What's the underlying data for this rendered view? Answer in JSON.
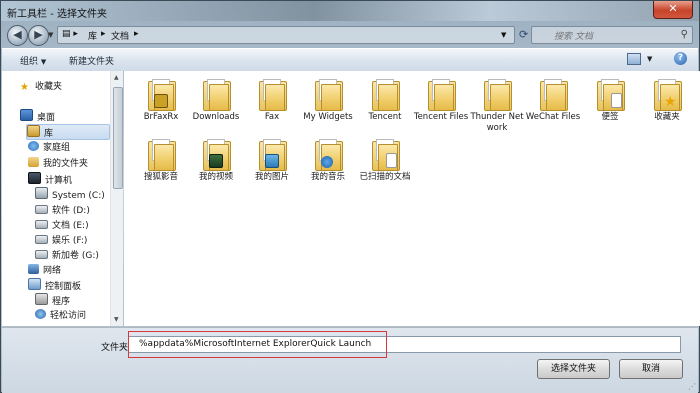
{
  "window": {
    "title": "新工具栏 - 选择文件夹",
    "close": "✕"
  },
  "address": {
    "crumbs": [
      "库",
      "文档"
    ],
    "search_placeholder": "搜索 文档"
  },
  "toolbar": {
    "organize": "组织",
    "new_folder": "新建文件夹",
    "help": "?"
  },
  "sidebar": {
    "items": [
      {
        "label": "收藏夹",
        "icon": "star-icon"
      },
      {
        "label": "桌面",
        "icon": "desktop-icon"
      },
      {
        "label": "库",
        "icon": "library-icon"
      },
      {
        "label": "家庭组",
        "icon": "homegroup-icon"
      },
      {
        "label": "我的文件夹",
        "icon": "user-folder-icon"
      },
      {
        "label": "计算机",
        "icon": "computer-icon"
      },
      {
        "label": "System (C:)",
        "icon": "system-drive-icon"
      },
      {
        "label": "软件 (D:)",
        "icon": "drive-icon"
      },
      {
        "label": "文档 (E:)",
        "icon": "drive-icon"
      },
      {
        "label": "娱乐 (F:)",
        "icon": "drive-icon"
      },
      {
        "label": "新加卷 (G:)",
        "icon": "drive-icon"
      },
      {
        "label": "网络",
        "icon": "network-icon"
      },
      {
        "label": "控制面板",
        "icon": "control-panel-icon"
      },
      {
        "label": "程序",
        "icon": "programs-icon"
      },
      {
        "label": "轻松访问",
        "icon": "ease-of-access-icon"
      }
    ]
  },
  "files": [
    {
      "label": "BrFaxRx",
      "badge": "lock"
    },
    {
      "label": "Downloads",
      "badge": ""
    },
    {
      "label": "Fax",
      "badge": ""
    },
    {
      "label": "My Widgets",
      "badge": ""
    },
    {
      "label": "Tencent",
      "badge": ""
    },
    {
      "label": "Tencent Files",
      "badge": ""
    },
    {
      "label": "Thunder Network",
      "badge": ""
    },
    {
      "label": "WeChat Files",
      "badge": ""
    },
    {
      "label": "便签",
      "badge": "doc"
    },
    {
      "label": "收藏夹",
      "badge": "star"
    },
    {
      "label": "搜狐影音",
      "badge": ""
    },
    {
      "label": "我的视频",
      "badge": "video"
    },
    {
      "label": "我的图片",
      "badge": "pic"
    },
    {
      "label": "我的音乐",
      "badge": "music"
    },
    {
      "label": "已扫描的文档",
      "badge": "doc"
    }
  ],
  "bottom": {
    "folder_label": "文件夹:",
    "folder_value": "%appdata%MicrosoftInternet ExplorerQuick Launch",
    "select_button": "选择文件夹",
    "cancel_button": "取消"
  }
}
